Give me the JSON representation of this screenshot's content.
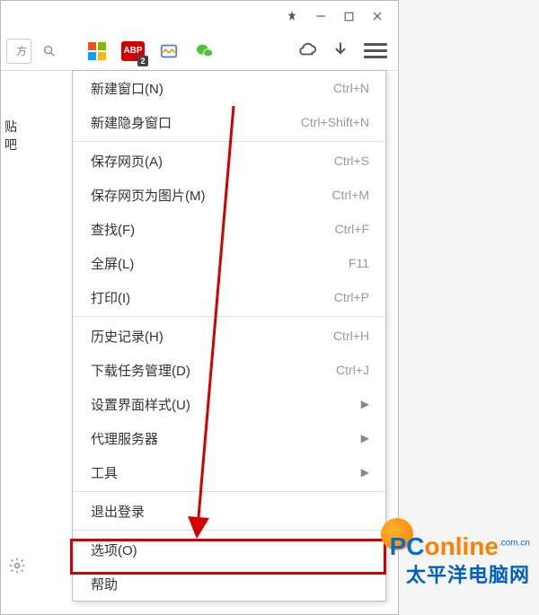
{
  "titlebar": {},
  "toolbar": {
    "addr_stub": "方",
    "abp_label": "ABP",
    "abp_badge": "2"
  },
  "left_text": "贴吧",
  "menu": {
    "groups": [
      [
        {
          "label": "新建窗口(N)",
          "shortcut": "Ctrl+N",
          "sub": false,
          "name": "new-window"
        },
        {
          "label": "新建隐身窗口",
          "shortcut": "Ctrl+Shift+N",
          "sub": false,
          "name": "new-incognito-window"
        }
      ],
      [
        {
          "label": "保存网页(A)",
          "shortcut": "Ctrl+S",
          "sub": false,
          "name": "save-page"
        },
        {
          "label": "保存网页为图片(M)",
          "shortcut": "Ctrl+M",
          "sub": false,
          "name": "save-page-as-image"
        },
        {
          "label": "查找(F)",
          "shortcut": "Ctrl+F",
          "sub": false,
          "name": "find"
        },
        {
          "label": "全屏(L)",
          "shortcut": "F11",
          "sub": false,
          "name": "fullscreen"
        },
        {
          "label": "打印(I)",
          "shortcut": "Ctrl+P",
          "sub": false,
          "name": "print"
        }
      ],
      [
        {
          "label": "历史记录(H)",
          "shortcut": "Ctrl+H",
          "sub": false,
          "name": "history"
        },
        {
          "label": "下载任务管理(D)",
          "shortcut": "Ctrl+J",
          "sub": false,
          "name": "downloads"
        },
        {
          "label": "设置界面样式(U)",
          "shortcut": "",
          "sub": true,
          "name": "ui-style"
        },
        {
          "label": "代理服务器",
          "shortcut": "",
          "sub": true,
          "name": "proxy"
        },
        {
          "label": "工具",
          "shortcut": "",
          "sub": true,
          "name": "tools"
        }
      ],
      [
        {
          "label": "退出登录",
          "shortcut": "",
          "sub": false,
          "name": "logout"
        }
      ],
      [
        {
          "label": "选项(O)",
          "shortcut": "",
          "sub": false,
          "name": "options",
          "highlighted": true
        },
        {
          "label": "帮助",
          "shortcut": "",
          "sub": false,
          "name": "help"
        }
      ]
    ]
  },
  "watermark": {
    "line1_a": "PC",
    "line1_b": "online",
    "line1_c": ".com.cn",
    "line2": "太平洋电脑网"
  }
}
